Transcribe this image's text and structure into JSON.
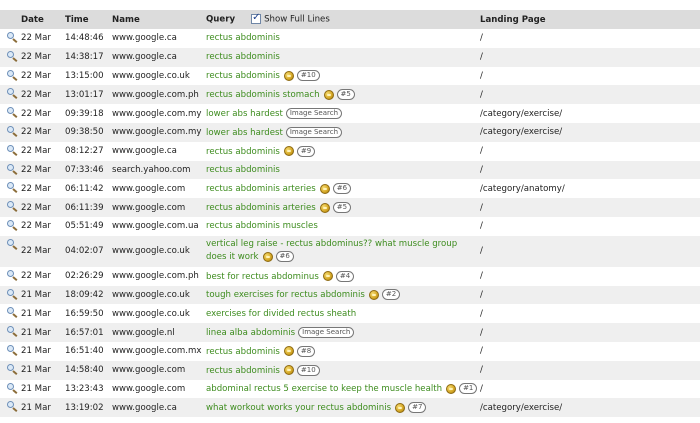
{
  "header": {
    "date": "Date",
    "time": "Time",
    "name": "Name",
    "query": "Query",
    "show_full_lines": "Show Full Lines",
    "landing": "Landing Page"
  },
  "rows": [
    {
      "date": "22 Mar",
      "time": "14:48:46",
      "name": "www.google.ca",
      "query": "rectus abdominis",
      "coin": false,
      "tag": "",
      "landing": "/"
    },
    {
      "date": "22 Mar",
      "time": "14:38:17",
      "name": "www.google.ca",
      "query": "rectus abdominis",
      "coin": false,
      "tag": "",
      "landing": "/"
    },
    {
      "date": "22 Mar",
      "time": "13:15:00",
      "name": "www.google.co.uk",
      "query": "rectus abdominis",
      "coin": true,
      "tag": "#10",
      "landing": "/"
    },
    {
      "date": "22 Mar",
      "time": "13:01:17",
      "name": "www.google.com.ph",
      "query": "rectus abdominis stomach",
      "coin": true,
      "tag": "#5",
      "landing": "/"
    },
    {
      "date": "22 Mar",
      "time": "09:39:18",
      "name": "www.google.com.my",
      "query": "lower abs hardest",
      "coin": false,
      "tag": "Image Search",
      "landing": "/category/exercise/"
    },
    {
      "date": "22 Mar",
      "time": "09:38:50",
      "name": "www.google.com.my",
      "query": "lower abs hardest",
      "coin": false,
      "tag": "Image Search",
      "landing": "/category/exercise/"
    },
    {
      "date": "22 Mar",
      "time": "08:12:27",
      "name": "www.google.ca",
      "query": "rectus abdominis",
      "coin": true,
      "tag": "#9",
      "landing": "/"
    },
    {
      "date": "22 Mar",
      "time": "07:33:46",
      "name": "search.yahoo.com",
      "query": "rectus abdominis",
      "coin": false,
      "tag": "",
      "landing": "/"
    },
    {
      "date": "22 Mar",
      "time": "06:11:42",
      "name": "www.google.com",
      "query": "rectus abdominis arteries",
      "coin": true,
      "tag": "#6",
      "landing": "/category/anatomy/"
    },
    {
      "date": "22 Mar",
      "time": "06:11:39",
      "name": "www.google.com",
      "query": "rectus abdominis arteries",
      "coin": true,
      "tag": "#5",
      "landing": "/"
    },
    {
      "date": "22 Mar",
      "time": "05:51:49",
      "name": "www.google.com.ua",
      "query": "rectus abdominis muscles",
      "coin": false,
      "tag": "",
      "landing": "/"
    },
    {
      "date": "22 Mar",
      "time": "04:02:07",
      "name": "www.google.co.uk",
      "query": "vertical leg raise - rectus abdominus?? what muscle group does it work",
      "coin": true,
      "tag": "#6",
      "landing": "/",
      "tall": true
    },
    {
      "date": "22 Mar",
      "time": "02:26:29",
      "name": "www.google.com.ph",
      "query": "best for rectus abdominus",
      "coin": true,
      "tag": "#4",
      "landing": "/"
    },
    {
      "date": "21 Mar",
      "time": "18:09:42",
      "name": "www.google.co.uk",
      "query": "tough exercises for rectus abdominis",
      "coin": true,
      "tag": "#2",
      "landing": "/"
    },
    {
      "date": "21 Mar",
      "time": "16:59:50",
      "name": "www.google.co.uk",
      "query": "exercises for divided rectus sheath",
      "coin": false,
      "tag": "",
      "landing": "/"
    },
    {
      "date": "21 Mar",
      "time": "16:57:01",
      "name": "www.google.nl",
      "query": "linea alba abdominis",
      "coin": false,
      "tag": "Image Search",
      "landing": "/"
    },
    {
      "date": "21 Mar",
      "time": "16:51:40",
      "name": "www.google.com.mx",
      "query": "rectus abdominis",
      "coin": true,
      "tag": "#8",
      "landing": "/"
    },
    {
      "date": "21 Mar",
      "time": "14:58:40",
      "name": "www.google.com",
      "query": "rectus abdominis",
      "coin": true,
      "tag": "#10",
      "landing": "/"
    },
    {
      "date": "21 Mar",
      "time": "13:23:43",
      "name": "www.google.com",
      "query": "abdominal rectus 5 exercise to keep the muscle health",
      "coin": true,
      "tag": "#1",
      "landing": "/"
    },
    {
      "date": "21 Mar",
      "time": "13:19:02",
      "name": "www.google.ca",
      "query": "what workout works your rectus abdominis",
      "coin": true,
      "tag": "#7",
      "landing": "/category/exercise/"
    }
  ]
}
